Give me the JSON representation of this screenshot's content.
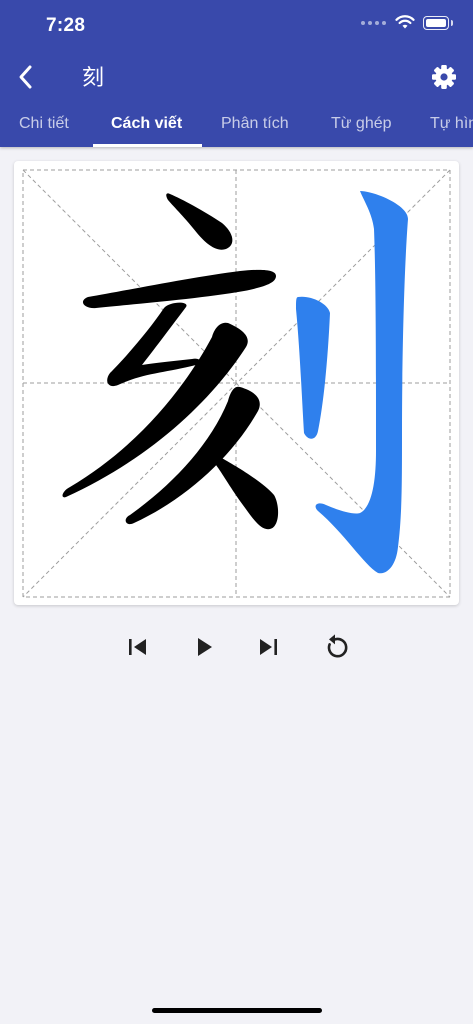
{
  "status_bar": {
    "time": "7:28"
  },
  "header": {
    "title": "刻"
  },
  "tabs": [
    {
      "label": "Chi tiết",
      "active": false
    },
    {
      "label": "Cách viết",
      "active": true
    },
    {
      "label": "Phân tích",
      "active": false
    },
    {
      "label": "Từ ghép",
      "active": false
    },
    {
      "label": "Tự hìn",
      "active": false
    }
  ],
  "stroke_animation": {
    "character": "刻",
    "completed_stroke_color": "#000000",
    "active_stroke_color": "#2f80ed",
    "guide_line_color": "#9e9e9e"
  },
  "controls": [
    "skip-previous-icon",
    "play-icon",
    "skip-next-icon",
    "replay-icon"
  ],
  "colors": {
    "header": "#3949ab",
    "background": "#f2f2f7",
    "accent": "#2f80ed"
  }
}
